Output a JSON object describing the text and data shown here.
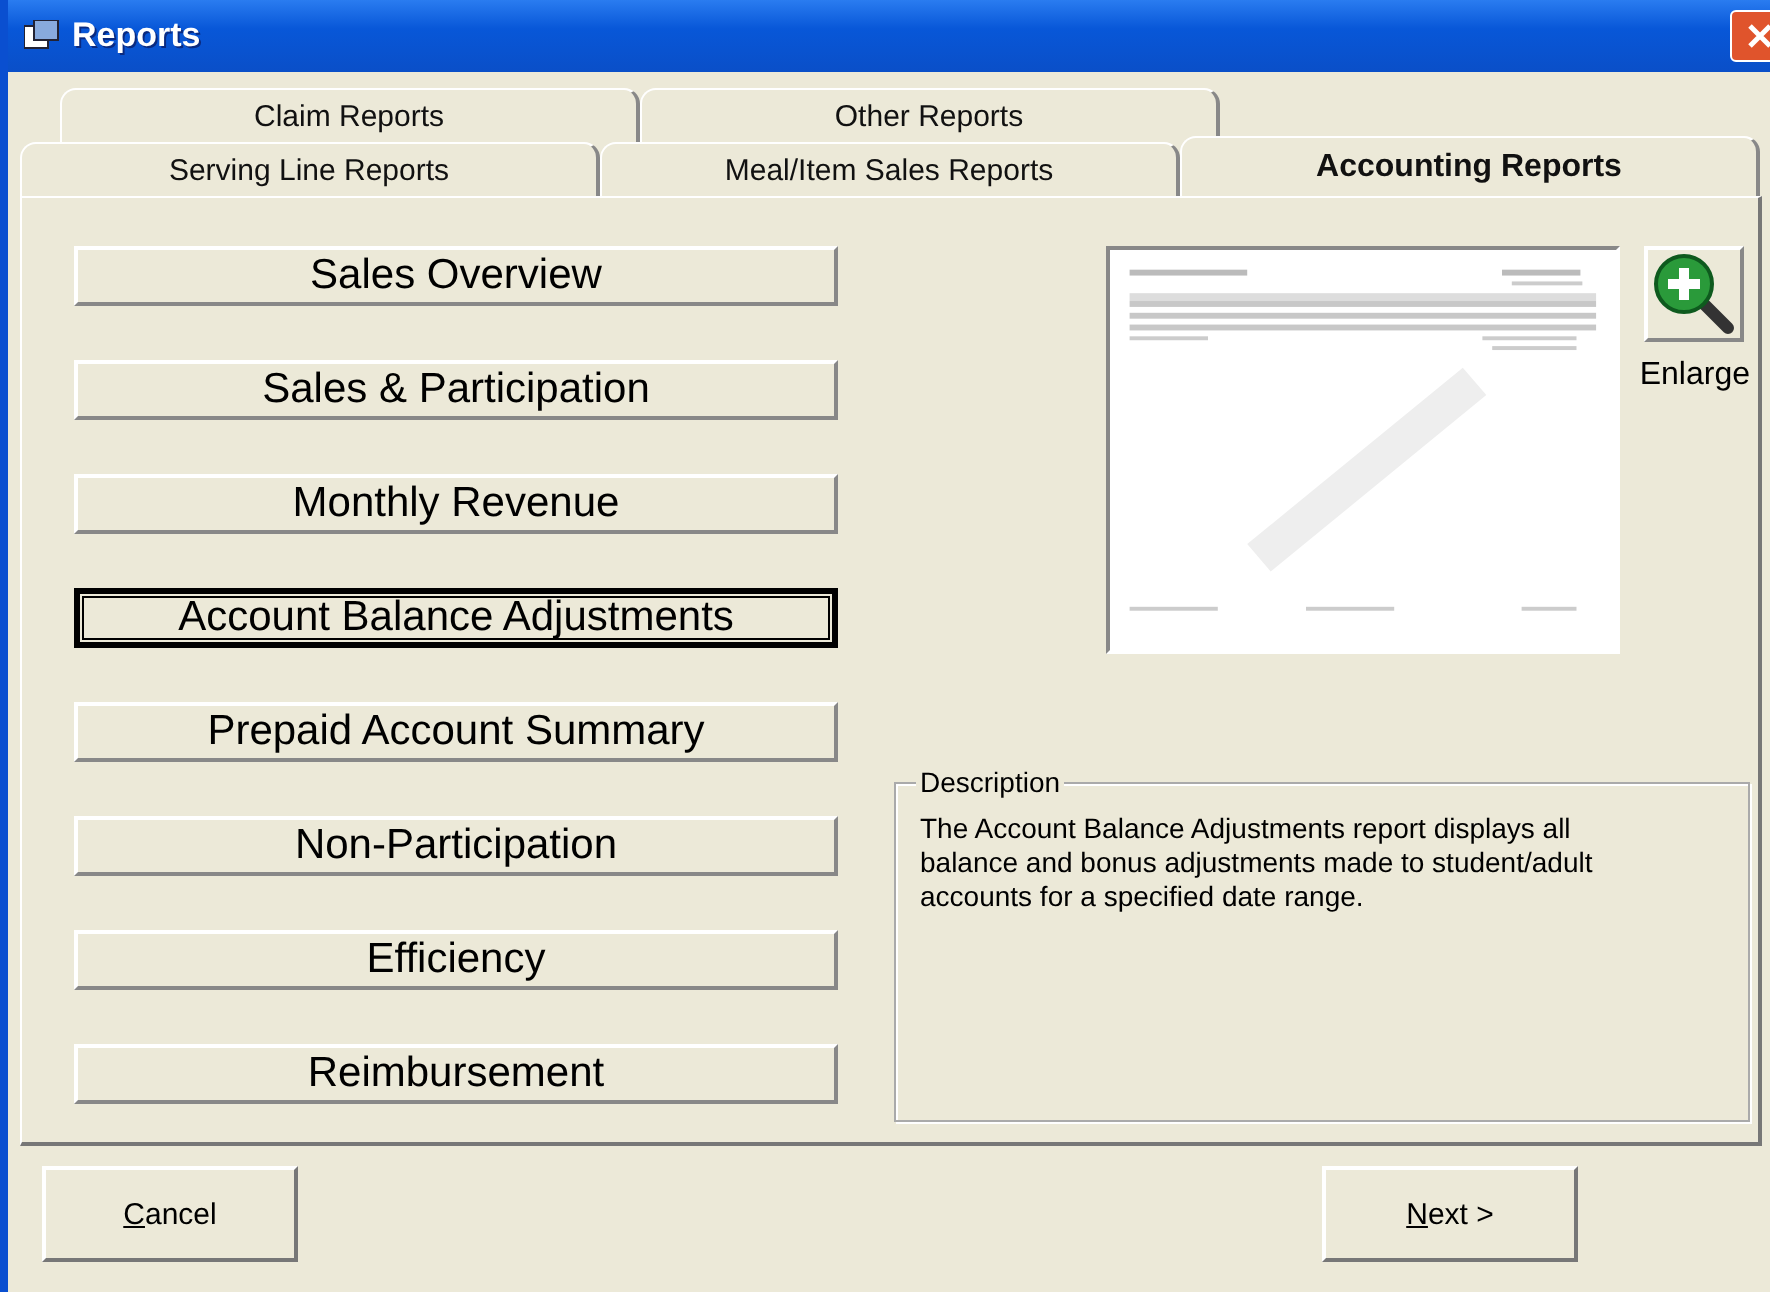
{
  "window": {
    "title": "Reports"
  },
  "tab_rows": [
    [
      {
        "label": "Claim Reports",
        "selected": false
      },
      {
        "label": "Other Reports",
        "selected": false
      }
    ],
    [
      {
        "label": "Serving Line Reports",
        "selected": false
      },
      {
        "label": "Meal/Item Sales Reports",
        "selected": false
      },
      {
        "label": "Accounting Reports",
        "selected": true
      }
    ]
  ],
  "reports": [
    {
      "label": "Sales Overview",
      "selected": false
    },
    {
      "label": "Sales & Participation",
      "selected": false
    },
    {
      "label": "Monthly Revenue",
      "selected": false
    },
    {
      "label": "Account Balance Adjustments",
      "selected": true
    },
    {
      "label": "Prepaid Account Summary",
      "selected": false
    },
    {
      "label": "Non-Participation",
      "selected": false
    },
    {
      "label": "Efficiency",
      "selected": false
    },
    {
      "label": "Reimbursement",
      "selected": false
    }
  ],
  "preview": {
    "enlarge_label": "Enlarge"
  },
  "description": {
    "legend": "Description",
    "text": "The Account Balance Adjustments report displays all balance and bonus adjustments made to student/adult accounts for a specified date range."
  },
  "buttons": [
    {
      "label": "Cancel"
    },
    {
      "label": "Next >"
    }
  ]
}
